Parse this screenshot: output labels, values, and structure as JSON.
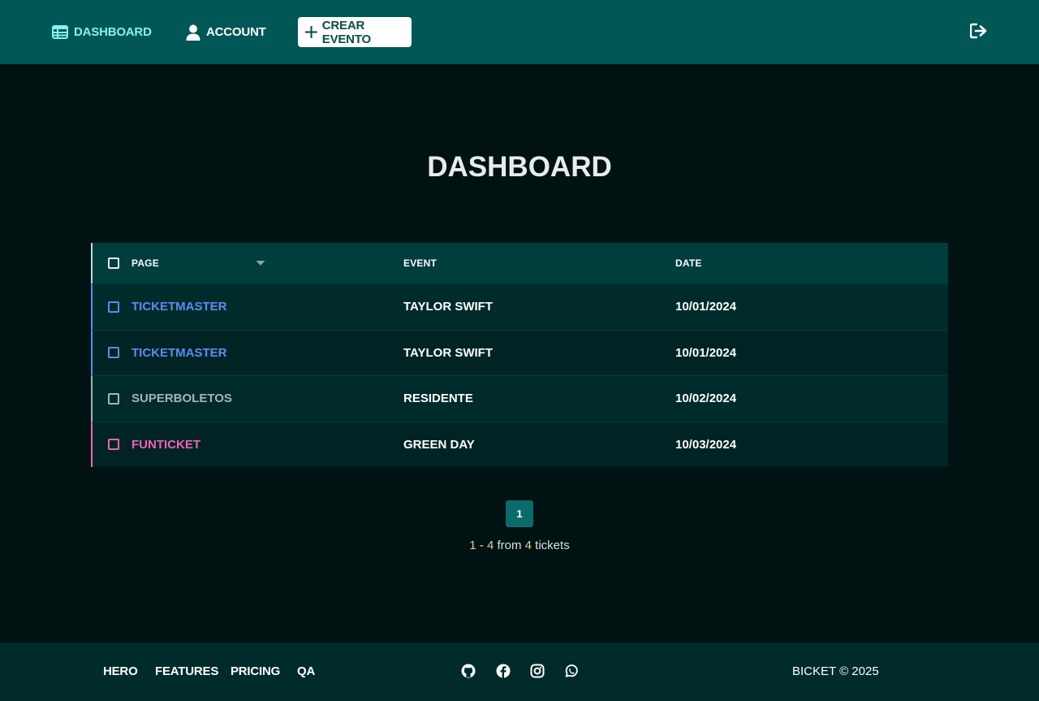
{
  "nav": {
    "dashboard_label": "DASHBOARD",
    "account_label": "ACCOUNT",
    "create_label": "CREAR EVENTO",
    "logout_icon": "sign-out-icon"
  },
  "page": {
    "title": "DASHBOARD"
  },
  "table": {
    "columns": [
      "PAGE",
      "EVENT",
      "DATE"
    ],
    "rows": [
      {
        "page": "TICKETMASTER",
        "event": "TAYLOR SWIFT",
        "date": "10/01/2024",
        "color": "#5b8cf5"
      },
      {
        "page": "TICKETMASTER",
        "event": "TAYLOR SWIFT",
        "date": "10/01/2024",
        "color": "#5b8cf5"
      },
      {
        "page": "SUPERBOLETOS",
        "event": "RESIDENTE",
        "date": "10/02/2024",
        "color": "#a8b3b3"
      },
      {
        "page": "FUNTICKET",
        "event": "GREEN DAY",
        "date": "10/03/2024",
        "color": "#f062b8"
      }
    ]
  },
  "pagination": {
    "current_page": "1",
    "range_start": "1",
    "range_sep": " - ",
    "range_end": "4",
    "from_word": " from ",
    "total": "4",
    "unit": " tickets"
  },
  "footer": {
    "links": [
      "HERO",
      "FEATURES",
      "PRICING",
      "QA"
    ],
    "social": [
      "github-icon",
      "facebook-icon",
      "instagram-icon",
      "whatsapp-icon"
    ],
    "copyright": "BICKET © 2025"
  },
  "colors": {
    "nav_bg": "#015656",
    "page_bg": "#001212",
    "accent": "#86f2ec"
  }
}
